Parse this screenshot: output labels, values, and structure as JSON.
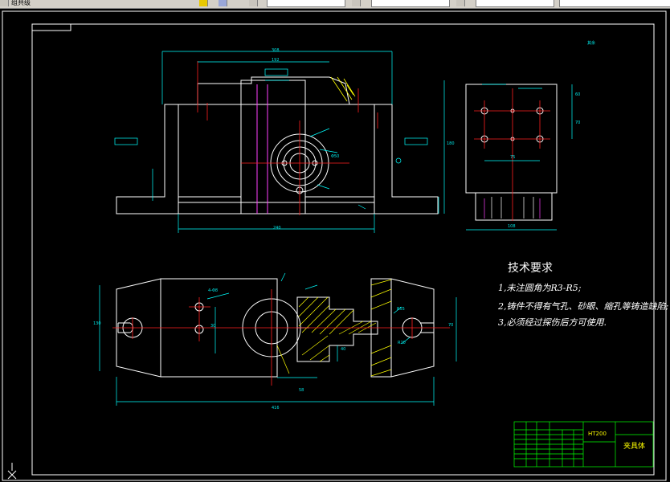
{
  "toolbar": {
    "title_fragment": "组共级",
    "fields": [
      "",
      "",
      "",
      ""
    ]
  },
  "drawing": {
    "tech_title": "技术要求",
    "tech_notes": [
      "1,未注圆角为R3-R5;",
      "2,铸件不得有气孔、砂眼、缩孔等铸造缺陷;",
      "3,必须经过探伤后方可使用."
    ],
    "title_block": {
      "material": "HT200",
      "part_name": "夹具体"
    },
    "roughness_note": "其余",
    "dimensions": {
      "top_width": "308",
      "inner_width": "192",
      "base_width": "240",
      "height_right": "180",
      "side_width": "108",
      "side_height": "60",
      "side_dim_75": "75",
      "side_dim_70": "70",
      "plan_length": "416",
      "plan_height": "130",
      "plan_70": "70",
      "plan_30": "30",
      "hole_4": "4-Φ8",
      "dia_50": "Φ50",
      "r_label": "R55",
      "thickness_58": "58",
      "dim_40": "40",
      "r20": "R20"
    },
    "colors": {
      "outline": "#ffffff",
      "center": "#ff2020",
      "dims": "#00ffff",
      "hidden": "#ff40ff",
      "hatch": "#ffff00",
      "block": "#00ff00"
    }
  }
}
